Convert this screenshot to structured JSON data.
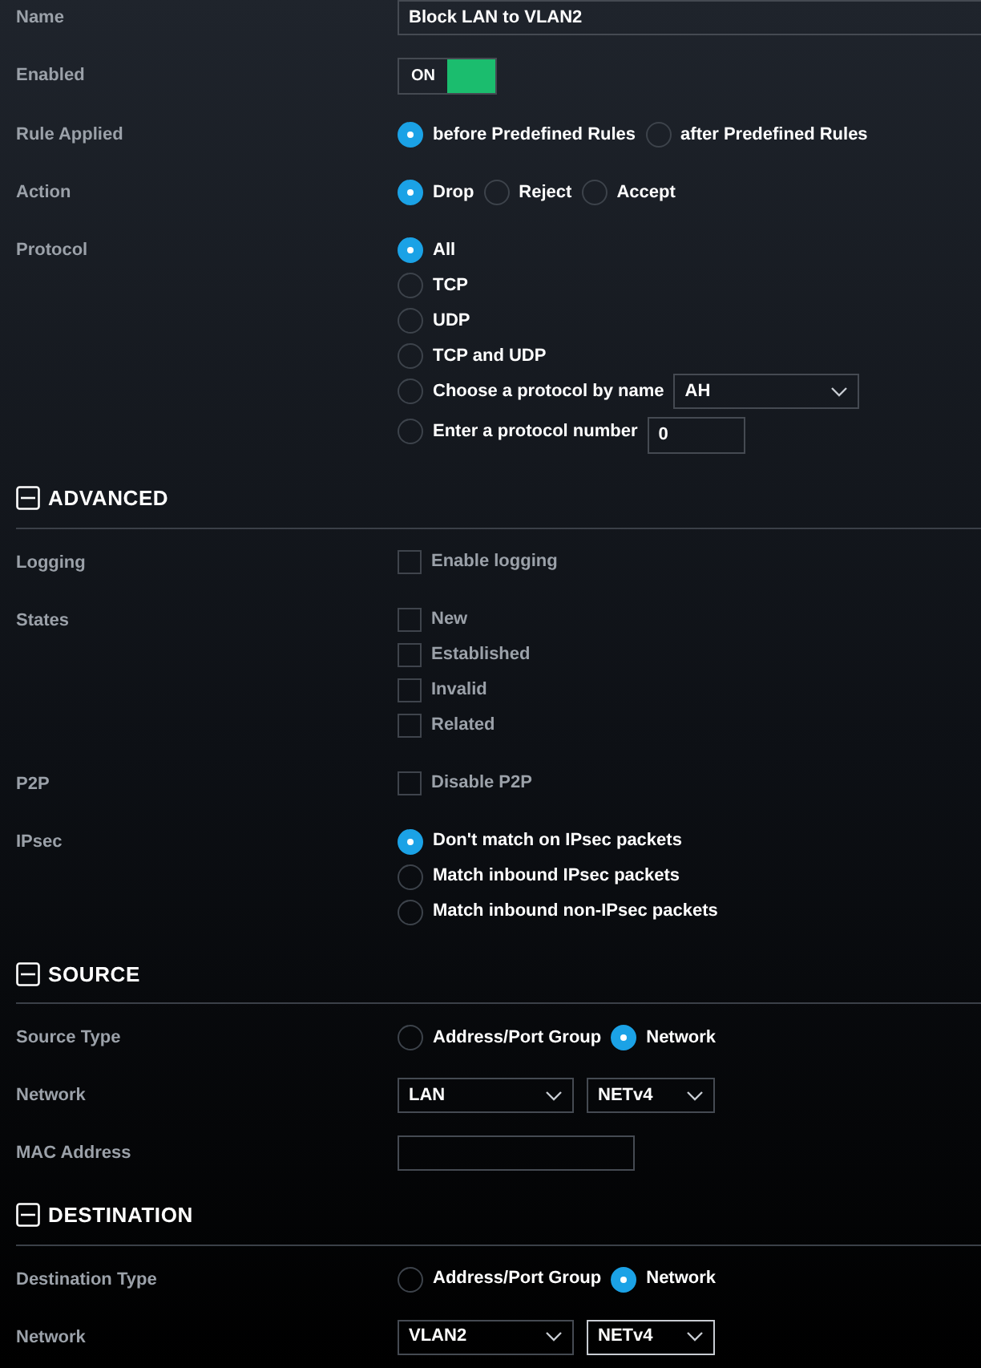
{
  "rows": [
    {
      "kind": "wide_text",
      "label": "Name",
      "value": "Block LAN to VLAN2"
    },
    {
      "kind": "toggle",
      "label": "Enabled",
      "on": true,
      "text": "ON"
    },
    {
      "kind": "radio_row",
      "label": "Rule Applied",
      "options": [
        {
          "label": "before Predefined Rules",
          "selected": true
        },
        {
          "label": "after Predefined Rules",
          "selected": false
        }
      ]
    },
    {
      "kind": "radio_row",
      "label": "Action",
      "options": [
        {
          "label": "Drop",
          "selected": true
        },
        {
          "label": "Reject",
          "selected": false
        },
        {
          "label": "Accept",
          "selected": false
        }
      ]
    },
    {
      "kind": "radio_list",
      "label": "Protocol",
      "options": [
        {
          "label": "All",
          "selected": true
        },
        {
          "label": "TCP",
          "selected": false
        },
        {
          "label": "UDP",
          "selected": false
        },
        {
          "label": "TCP and UDP",
          "selected": false
        },
        {
          "label": "Choose a protocol by name",
          "selected": false,
          "extra": {
            "kind": "select",
            "value": "AH"
          }
        },
        {
          "label": "Enter a protocol number",
          "selected": false,
          "extra": {
            "kind": "input",
            "value": "0"
          }
        }
      ]
    }
  ],
  "sections": [
    {
      "title": "ADVANCED",
      "expanded": true,
      "rows": [
        {
          "kind": "checks",
          "label": "Logging",
          "options": [
            {
              "label": "Enable logging",
              "checked": false
            }
          ]
        },
        {
          "kind": "checks",
          "label": "States",
          "options": [
            {
              "label": "New",
              "checked": false
            },
            {
              "label": "Established",
              "checked": false
            },
            {
              "label": "Invalid",
              "checked": false
            },
            {
              "label": "Related",
              "checked": false
            }
          ]
        },
        {
          "kind": "checks",
          "label": "P2P",
          "options": [
            {
              "label": "Disable P2P",
              "checked": false
            }
          ]
        },
        {
          "kind": "radio_list",
          "label": "IPsec",
          "options": [
            {
              "label": "Don't match on IPsec packets",
              "selected": true
            },
            {
              "label": "Match inbound IPsec packets",
              "selected": false
            },
            {
              "label": "Match inbound non-IPsec packets",
              "selected": false
            }
          ]
        }
      ]
    },
    {
      "title": "SOURCE",
      "expanded": true,
      "rows": [
        {
          "kind": "radio_row",
          "label": "Source Type",
          "options": [
            {
              "label": "Address/Port Group",
              "selected": false
            },
            {
              "label": "Network",
              "selected": true
            }
          ]
        },
        {
          "kind": "selects",
          "label": "Network",
          "selects": [
            {
              "value": "LAN",
              "focused": false
            },
            {
              "value": "NETv4",
              "focused": false
            }
          ]
        },
        {
          "kind": "text",
          "label": "MAC Address"
        }
      ]
    },
    {
      "title": "DESTINATION",
      "expanded": true,
      "rows": [
        {
          "kind": "radio_row",
          "label": "Destination Type",
          "options": [
            {
              "label": "Address/Port Group",
              "selected": false
            },
            {
              "label": "Network",
              "selected": true
            }
          ]
        },
        {
          "kind": "selects",
          "label": "Network",
          "selects": [
            {
              "value": "VLAN2",
              "focused": false
            },
            {
              "value": "NETv4",
              "focused": true
            }
          ]
        }
      ]
    }
  ]
}
